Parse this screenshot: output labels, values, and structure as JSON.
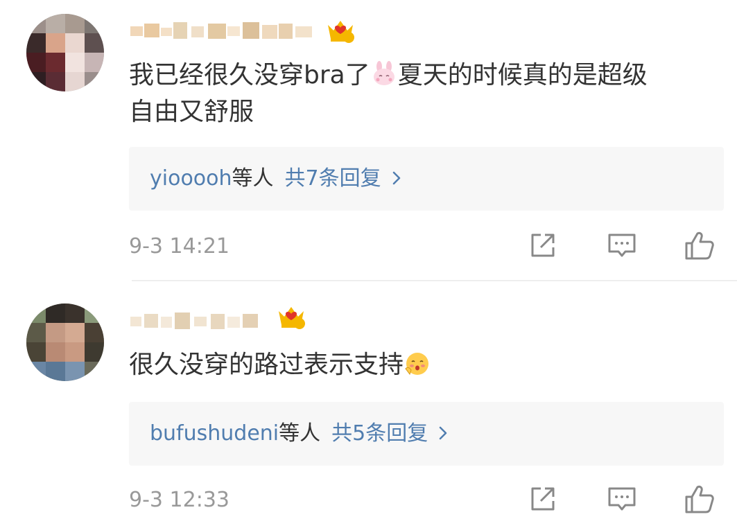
{
  "comments": [
    {
      "comment_text_line1": "我已经很久没穿bra了",
      "comment_text_after_emoji": "夏天的时候真的是超级",
      "comment_text_line2": "自由又舒服",
      "inline_emoji": "bunny-emoji",
      "user_badge": "crown-level-badge",
      "badge_level": "4",
      "reply_users": "yiooooh",
      "reply_suffix": "等人",
      "reply_count_text": "共7条回复",
      "timestamp": "9-3 14:21"
    },
    {
      "comment_text_line1": "很久没穿的路过表示支持",
      "inline_emoji": "blushing-face-emoji",
      "user_badge": "crown-level-badge",
      "badge_level": "6",
      "reply_users": "bufushudeni",
      "reply_suffix": "等人",
      "reply_count_text": "共5条回复",
      "timestamp": "9-3 12:33"
    }
  ],
  "actions": {
    "forward_icon": "forward-icon",
    "reply_icon": "comment-icon",
    "like_icon": "thumbs-up-icon"
  },
  "colors": {
    "link_blue": "#507daf",
    "text_dark": "#333333",
    "meta_gray": "#999999",
    "reply_box_bg": "#f7f7f7",
    "crown_gold": "#f5b700",
    "crown_red": "#e0342a"
  }
}
